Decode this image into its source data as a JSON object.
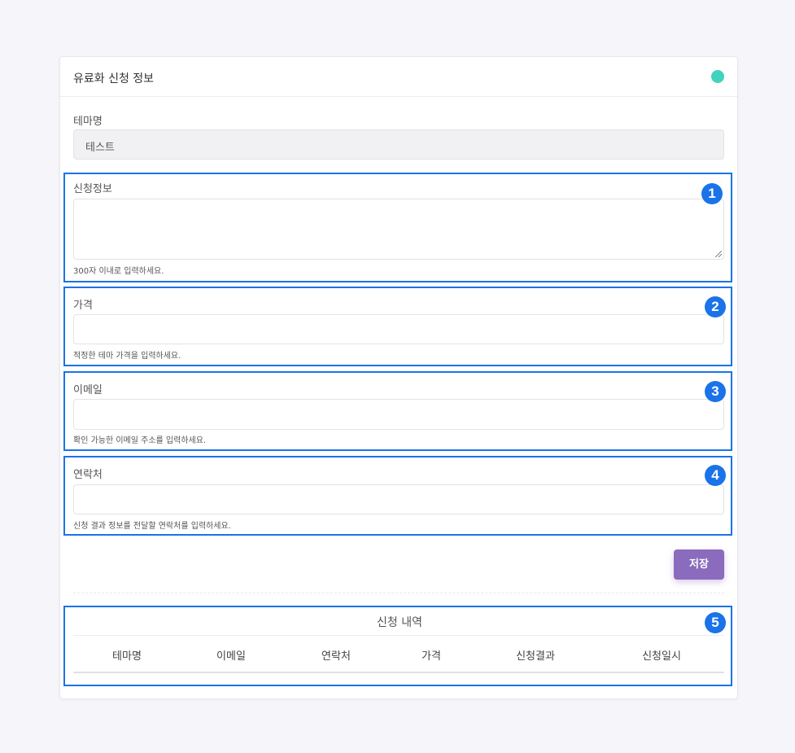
{
  "card": {
    "title": "유료화 신청 정보",
    "status_color": "#40d3c0"
  },
  "theme_name": {
    "label": "테마명",
    "value": "테스트"
  },
  "apply_info": {
    "label": "신청정보",
    "value": "",
    "help": "300자 이내로 입력하세요."
  },
  "price": {
    "label": "가격",
    "value": "",
    "help": "적정한 테마 가격을 입력하세요."
  },
  "email": {
    "label": "이메일",
    "value": "",
    "help": "확인 가능한 이메일 주소를 입력하세요."
  },
  "contact": {
    "label": "연락처",
    "value": "",
    "help": "신청 결과 정보를 전달할 연락처를 입력하세요."
  },
  "save_label": "저장",
  "history": {
    "title": "신청 내역",
    "columns": [
      "테마명",
      "이메일",
      "연락처",
      "가격",
      "신청결과",
      "신청일시"
    ]
  },
  "markers": [
    "1",
    "2",
    "3",
    "4",
    "5"
  ],
  "colors": {
    "accent": "#8a6bbd",
    "highlight": "#1a73e8"
  }
}
